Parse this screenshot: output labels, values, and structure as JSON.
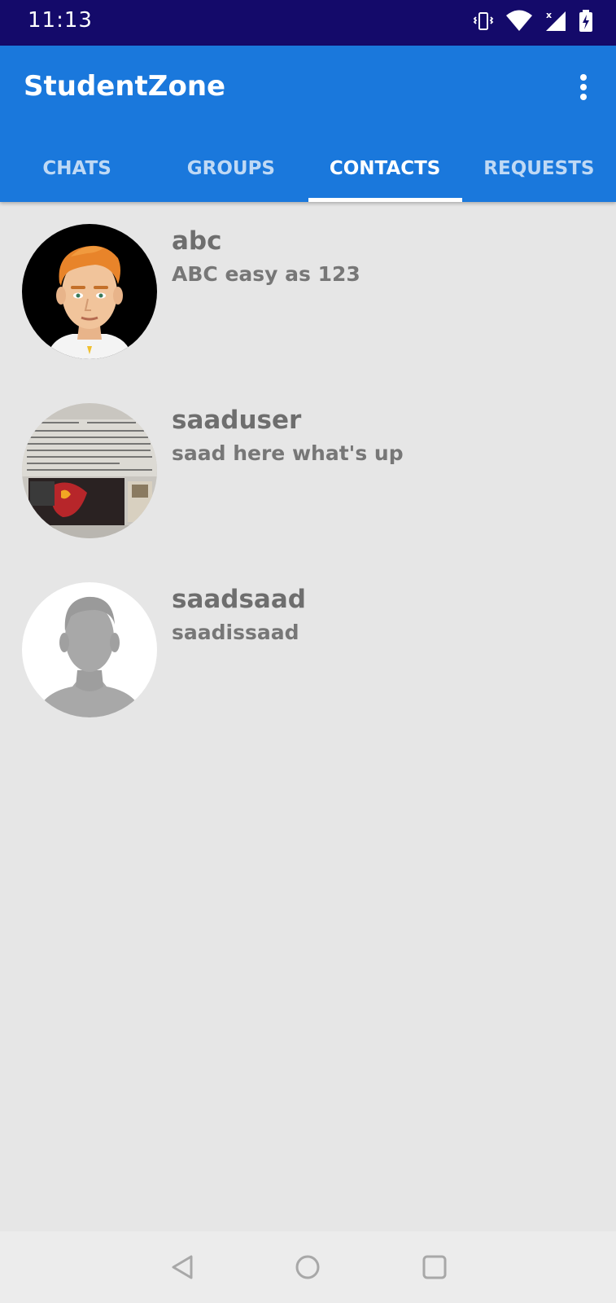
{
  "status_bar": {
    "time": "11:13",
    "icons": [
      "vibrate-icon",
      "wifi-icon",
      "cell-signal-icon",
      "battery-charging-icon"
    ]
  },
  "app_bar": {
    "title": "StudentZone",
    "menu_icon": "more-vert-icon"
  },
  "tabs": [
    {
      "label": "CHATS",
      "active": false
    },
    {
      "label": "GROUPS",
      "active": false
    },
    {
      "label": "CONTACTS",
      "active": true
    },
    {
      "label": "REQUESTS",
      "active": false
    }
  ],
  "contacts": [
    {
      "name": "abc",
      "status": "ABC easy as 123",
      "avatar": "cartoon-man-avatar"
    },
    {
      "name": "saaduser",
      "status": "saad here what's up",
      "avatar": "photo-avatar"
    },
    {
      "name": "saadsaad",
      "status": "saadissaad",
      "avatar": "default-person-avatar"
    }
  ],
  "nav_bar": {
    "buttons": [
      "back-icon",
      "home-icon",
      "recents-icon"
    ]
  },
  "colors": {
    "status_bar": "#140a6a",
    "app_bar": "#1a78dc",
    "background": "#e6e6e6",
    "text_primary": "#6e6e6e"
  }
}
